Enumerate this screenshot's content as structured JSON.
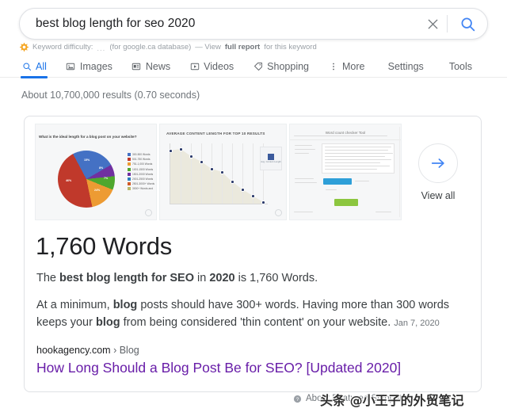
{
  "search": {
    "query": "best blog length for seo 2020",
    "placeholder": "Search",
    "clear_icon": "close-icon",
    "search_icon": "search-icon",
    "accent": "#4285f4"
  },
  "keyword_difficulty": {
    "icon": "moz-bar-icon",
    "label": "Keyword difficulty:",
    "value": "...",
    "database": "(for google.ca database)",
    "dash": "— View",
    "link": "full report",
    "suffix": "for this keyword"
  },
  "nav": {
    "tabs": [
      {
        "label": "All",
        "icon": "search-icon",
        "active": true
      },
      {
        "label": "Images",
        "icon": "image-icon",
        "active": false
      },
      {
        "label": "News",
        "icon": "news-icon",
        "active": false
      },
      {
        "label": "Videos",
        "icon": "video-icon",
        "active": false
      },
      {
        "label": "Shopping",
        "icon": "tag-icon",
        "active": false
      },
      {
        "label": "More",
        "icon": "kebab-icon",
        "active": false
      }
    ],
    "settings": "Settings",
    "tools": "Tools",
    "active_color": "#1a73e8"
  },
  "result_stats": "About 10,700,000 results (0.70 seconds)",
  "snippet": {
    "answer_number": "1,760 Words",
    "sentence": {
      "p1": "The ",
      "b1": "best blog length for SEO",
      "p2": " in ",
      "b2": "2020",
      "p3": " is 1,760 Words."
    },
    "paragraph": {
      "p1": "At a minimum, ",
      "b1": "blog",
      "p2": " posts should have 300+ words. Having more than 300 words keeps your ",
      "b2": "blog",
      "p3": " from being considered 'thin content' on your website.",
      "date": "Jan 7, 2020"
    },
    "source_domain": "hookagency.com",
    "source_crumb": "› Blog",
    "source_title": "How Long Should a Blog Post Be for SEO? [Updated 2020]",
    "title_color": "#681da8",
    "view_all": {
      "label": "View all",
      "icon": "arrow-right-icon",
      "arrow_color": "#4285f4"
    }
  },
  "chart_data": [
    {
      "type": "pie",
      "title": "What is the ideal length for a blog post on your website?",
      "categories": [
        "300-500 Words",
        "501-750 Words",
        "751-1,000 Words",
        "1001-1500 Words",
        "1501-2000 Words",
        "2001-2500 Words",
        "2501-3000+ Words",
        "3000+ Words and"
      ],
      "values": [
        24,
        7,
        8,
        15,
        46
      ],
      "slice_labels": [
        "24%",
        "7%",
        "8%",
        "15%",
        "46%"
      ],
      "colors": [
        "#4471c4",
        "#7030a0",
        "#4ea72e",
        "#ed9b33",
        "#c0392b"
      ],
      "legend_position": "right",
      "legend_colors": [
        "#4471c4",
        "#c0392b",
        "#ed9b33",
        "#4ea72e",
        "#7030a0",
        "#2b7fbd",
        "#d05a28",
        "#b9b96a"
      ]
    },
    {
      "type": "area",
      "title": "AVERAGE CONTENT LENGTH FOR TOP 10 RESULTS",
      "x": [
        1,
        2,
        3,
        4,
        5,
        6,
        7,
        8,
        9,
        10
      ],
      "values": [
        88,
        92,
        80,
        72,
        62,
        58,
        45,
        34,
        25,
        16
      ],
      "ylabel": "",
      "xlabel": "",
      "grid": true,
      "annotation": "Avg. Content Length",
      "marker_color": "#2b3a6b",
      "fill_color": "#ebe9dd"
    },
    {
      "type": "table",
      "title": "Word count checker Tool",
      "categories": [],
      "values": []
    }
  ],
  "footer": {
    "icon": "question-mark-icon",
    "label": "About Featured Snippets",
    "watermark": "头条 @小王子的外贸笔记"
  }
}
